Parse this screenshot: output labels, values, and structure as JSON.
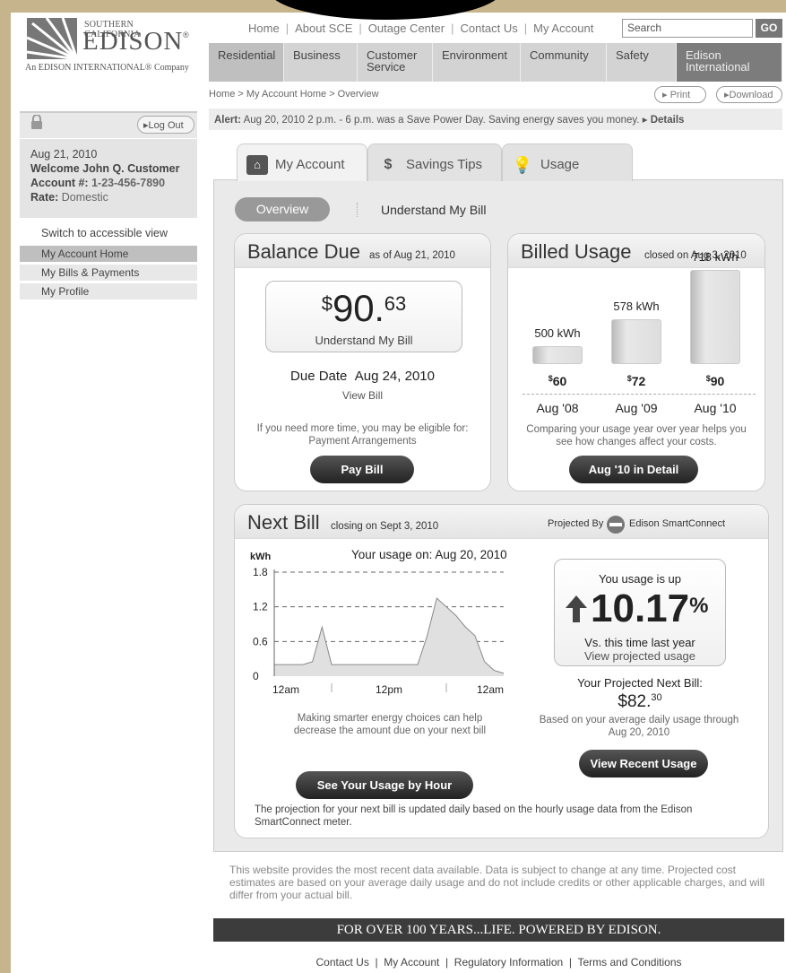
{
  "header": {
    "logo_top": "SOUTHERN CALIFORNIA",
    "logo_main": "EDISON",
    "logo_reg": "®",
    "logo_sub": "An EDISON INTERNATIONAL® Company",
    "top_links": [
      "Home",
      "About SCE",
      "Outage Center",
      "Contact Us",
      "My Account"
    ],
    "search_placeholder": "Search",
    "go_label": "GO",
    "main_nav": [
      "Residential",
      "Business",
      "Customer Service",
      "Environment",
      "Community",
      "Safety",
      "Edison International"
    ]
  },
  "breadcrumb": "Home > My Account Home > Overview",
  "print_label": "Print",
  "download_label": "Download",
  "alert": {
    "prefix": "Alert:",
    "text": "Aug 20, 2010 2 p.m. - 6 p.m. was a Save Power Day. Saving energy saves you money.",
    "details": "Details"
  },
  "sidebar": {
    "logout": "Log Out",
    "date": "Aug 21, 2010",
    "welcome": "Welcome John Q. Customer",
    "account_label": "Account #:",
    "account_number": "1-23-456-7890",
    "rate_label": "Rate:",
    "rate_value": "Domestic",
    "accessible": "Switch to accessible view",
    "nav": [
      "My Account Home",
      "My Bills & Payments",
      "My Profile"
    ]
  },
  "tabs": [
    "My Account",
    "Savings Tips",
    "Usage"
  ],
  "subtabs": [
    "Overview",
    "Understand My Bill"
  ],
  "balance": {
    "title": "Balance Due",
    "as_of": "as of Aug 21, 2010",
    "currency": "$",
    "dollars": "90",
    "cents": "63",
    "understand": "Understand My Bill",
    "due_label": "Due Date",
    "due_date": "Aug 24, 2010",
    "view_bill": "View Bill",
    "more_time": "If you need more time, you may be eligible for:",
    "arrangements": "Payment Arrangements",
    "pay_button": "Pay Bill"
  },
  "billed": {
    "title": "Billed Usage",
    "closed": "closed on Aug 3, 2010",
    "bars": [
      {
        "kwh": "500 kWh",
        "cost_sym": "$",
        "cost": "60",
        "label": "Aug '08",
        "value": 500
      },
      {
        "kwh": "578 kWh",
        "cost_sym": "$",
        "cost": "72",
        "label": "Aug '09",
        "value": 578
      },
      {
        "kwh": "718 kWh",
        "cost_sym": "$",
        "cost": "90",
        "label": "Aug '10",
        "value": 718
      }
    ],
    "compare": "Comparing your usage year over year helps you see how changes affect your costs.",
    "detail_button": "Aug '10 in Detail"
  },
  "nextbill": {
    "title": "Next Bill",
    "closing": "closing on Sept 3, 2010",
    "projected_by": "Projected By",
    "smartconnect": "Edison SmartConnect",
    "usage_on": "Your usage on: Aug 20, 2010",
    "smarter": "Making smarter energy choices can help decrease the amount due on your next bill",
    "usage_button": "See Your Usage by Hour",
    "usage_up": "You usage is up",
    "percent": "10.17",
    "percent_sym": "%",
    "vs": "Vs. this time last year",
    "view_projected": "View projected usage",
    "proj_label": "Your Projected Next Bill:",
    "proj_dollars": "$82.",
    "proj_cents": "30",
    "based": "Based on your average daily usage through Aug 20, 2010",
    "recent_button": "View Recent Usage",
    "footnote": "The projection for your next bill is updated daily based on the hourly usage data from the Edison SmartConnect meter."
  },
  "chart_data": {
    "type": "area",
    "ylabel": "kWh",
    "yticks": [
      "1.8",
      "1.2",
      "0.6",
      "0"
    ],
    "ylim": [
      0,
      1.8
    ],
    "xticks": [
      "12am",
      "12pm",
      "12am"
    ],
    "x": [
      0,
      1,
      2,
      3,
      4,
      5,
      6,
      7,
      8,
      9,
      10,
      11,
      12,
      13,
      14,
      15,
      16,
      17,
      18,
      19,
      20,
      21,
      22,
      23,
      24
    ],
    "values": [
      0.2,
      0.2,
      0.2,
      0.2,
      0.25,
      0.85,
      0.2,
      0.2,
      0.2,
      0.2,
      0.2,
      0.2,
      0.2,
      0.2,
      0.2,
      0.2,
      0.7,
      1.35,
      1.2,
      1.05,
      0.85,
      0.7,
      0.25,
      0.1,
      0.05
    ],
    "grid": true
  },
  "disclaimer": "This website provides the most recent data available. Data is subject to change at any time. Projected cost estimates are based on your average daily usage and do not include credits or other applicable charges, and will differ from your actual bill.",
  "banner": "FOR OVER 100 YEARS...LIFE. POWERED BY EDISON.",
  "footer_links": [
    "Contact Us",
    "My Account",
    "Regulatory Information",
    "Terms and Conditions"
  ]
}
